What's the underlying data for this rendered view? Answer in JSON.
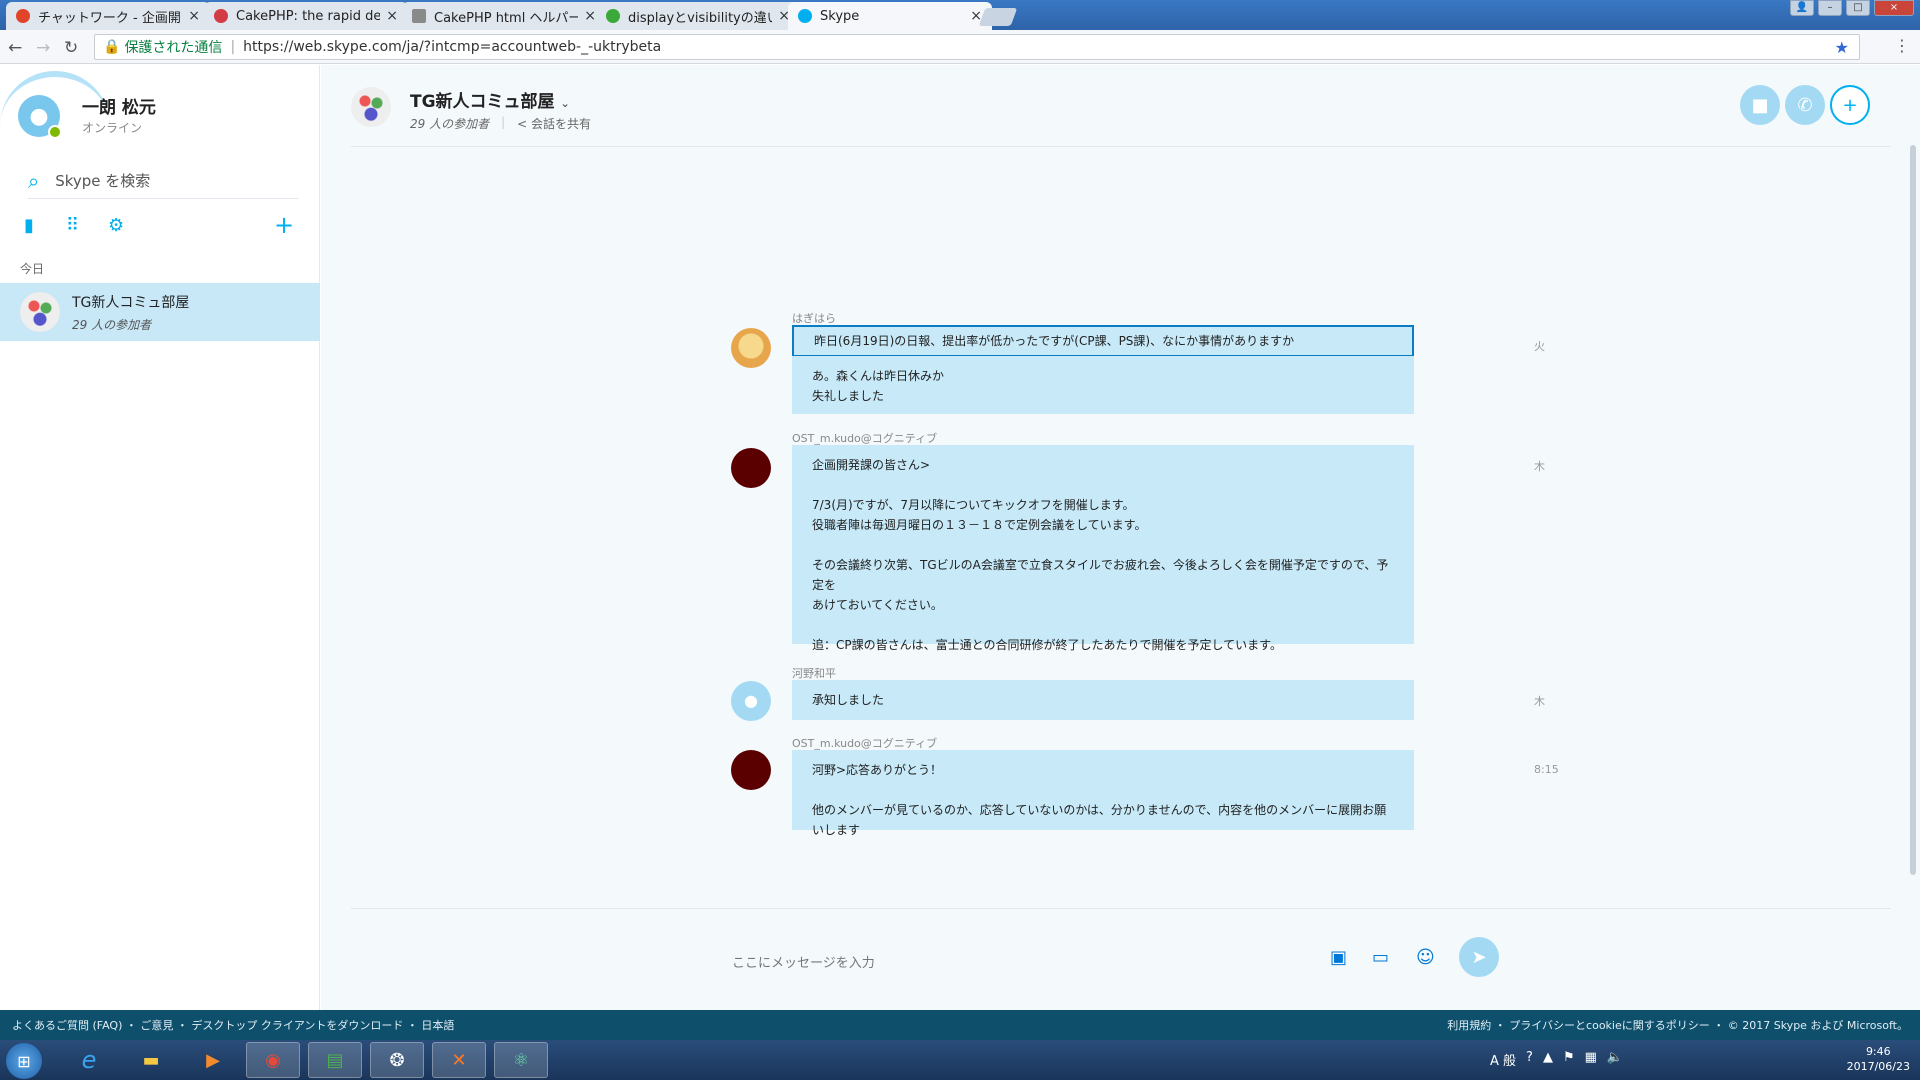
{
  "browser": {
    "tabs": [
      {
        "title": "チャットワーク - 企画開",
        "fav_color": "#e0442a"
      },
      {
        "title": "CakePHP: the rapid de",
        "fav_color": "#d33c44"
      },
      {
        "title": "CakePHP html ヘルパー",
        "fav_color": "#8a8a8a"
      },
      {
        "title": "displayとvisibilityの違い",
        "fav_color": "#3aa93a"
      },
      {
        "title": "Skype",
        "fav_color": "#00aff0"
      }
    ],
    "secure_label": "保護された通信",
    "url": "https://web.skype.com/ja/?intcmp=accountweb-_-uktrybeta"
  },
  "sidebar": {
    "user_name": "一朗 松元",
    "user_status": "オンライン",
    "search_placeholder": "Skype を検索",
    "section_label": "今日",
    "conversation": {
      "title": "TG新人コミュ部屋",
      "subtitle": "29 人の参加者"
    }
  },
  "chat": {
    "title": "TG新人コミュ部屋",
    "participants": "29 人の参加者",
    "share_label": "会話を共有",
    "messages": [
      {
        "sender": "はぎはら",
        "bubbles": [
          "昨日(6月19日)の日報、提出率が低かったですが(CP課、PS課)、なにか事情がありますか",
          "あ。森くんは昨日休みか\n失礼しました"
        ],
        "time": "火"
      },
      {
        "sender": "OST_m.kudo@コグニティブ",
        "bubbles": [
          "企画開発課の皆さん>\n\n7/3(月)ですが、7月以降についてキックオフを開催します。\n役職者陣は毎週月曜日の１３－１８で定例会議をしています。\n\nその会議終り次第、TGビルのA会議室で立食スタイルでお疲れ会、今後よろしく会を開催予定ですので、予定を\nあけておいてください。\n\n追：CP課の皆さんは、富士通との合同研修が終了したあたりで開催を予定しています。"
        ],
        "time": "木"
      },
      {
        "sender": "河野和平",
        "bubbles": [
          "承知しました"
        ],
        "time": "木"
      },
      {
        "sender": "OST_m.kudo@コグニティブ",
        "bubbles": [
          "河野>応答ありがとう！\n\n他のメンバーが見ているのか、応答していないのかは、分かりませんので、内容を他のメンバーに展開お願いします"
        ],
        "time": "8:15"
      }
    ],
    "input_placeholder": "ここにメッセージを入力"
  },
  "footer": {
    "left": "よくあるご質問 (FAQ) ・ ご意見 ・ デスクトップ クライアントをダウンロード ・ 日本語",
    "right": "利用規約 ・ プライバシーとcookieに関するポリシー ・ © 2017 Skype および Microsoft。"
  },
  "taskbar": {
    "time": "9:46",
    "date": "2017/06/23",
    "ime": "A 般"
  }
}
